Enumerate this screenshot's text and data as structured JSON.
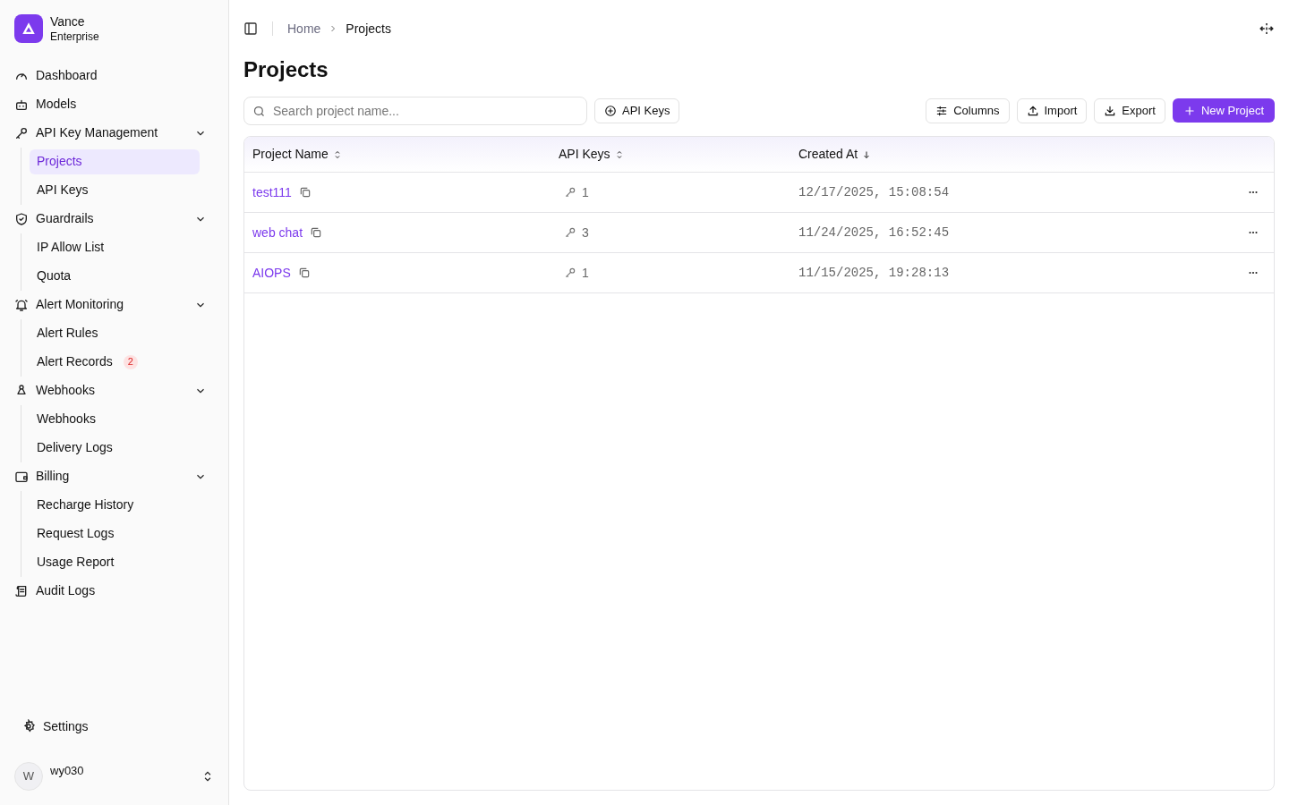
{
  "brand": {
    "name": "Vance",
    "subtitle": "Enterprise"
  },
  "nav": [
    {
      "label": "Dashboard"
    },
    {
      "label": "Models"
    },
    {
      "label": "API Key Management",
      "expanded": true,
      "children": [
        {
          "label": "Projects",
          "selected": true
        },
        {
          "label": "API Keys",
          "selected": false
        }
      ]
    },
    {
      "label": "Guardrails",
      "expanded": true,
      "children": [
        {
          "label": "IP Allow List",
          "selected": false
        },
        {
          "label": "Quota",
          "selected": false
        }
      ]
    },
    {
      "label": "Alert Monitoring",
      "expanded": true,
      "children": [
        {
          "label": "Alert Rules",
          "selected": false
        },
        {
          "label": "Alert Records",
          "selected": false,
          "badge": "2"
        }
      ]
    },
    {
      "label": "Webhooks",
      "expanded": true,
      "children": [
        {
          "label": "Webhooks",
          "selected": false
        },
        {
          "label": "Delivery Logs",
          "selected": false
        }
      ]
    },
    {
      "label": "Billing",
      "expanded": true,
      "children": [
        {
          "label": "Recharge History",
          "selected": false
        },
        {
          "label": "Request Logs",
          "selected": false
        },
        {
          "label": "Usage Report",
          "selected": false
        }
      ]
    },
    {
      "label": "Audit Logs"
    }
  ],
  "settings": "Settings",
  "user": {
    "initial": "W",
    "name": "wy030"
  },
  "breadcrumb": [
    "Home",
    "Projects"
  ],
  "title": "Projects",
  "search": {
    "placeholder": "Search project name..."
  },
  "toolbar_left": [
    {
      "label": "API Keys"
    }
  ],
  "toolbar_right": [
    {
      "label": "Columns",
      "kind": "outline"
    },
    {
      "label": "Import",
      "kind": "outline"
    },
    {
      "label": "Export",
      "kind": "outline"
    },
    {
      "label": "New Project",
      "kind": "primary"
    }
  ],
  "table": {
    "columns": [
      {
        "label": "Project Name"
      },
      {
        "label": "API Keys"
      },
      {
        "label": "Created At"
      }
    ],
    "rows": [
      {
        "name": "test111",
        "keys": "1",
        "created": "12/17/2025, 15:08:54"
      },
      {
        "name": "web chat",
        "keys": "3",
        "created": "11/24/2025, 16:52:45"
      },
      {
        "name": "AIOPS",
        "keys": "1",
        "created": "11/15/2025, 19:28:13"
      }
    ]
  }
}
